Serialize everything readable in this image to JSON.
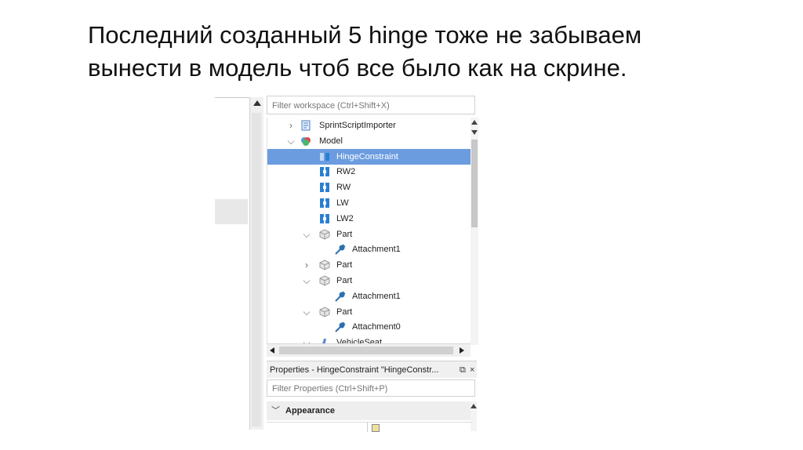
{
  "slide": {
    "title_line1": "Последний созданный 5 hinge тоже не забываем",
    "title_line2": "вынести в модель чтоб все было как на скрине."
  },
  "explorer": {
    "filter_placeholder": "Filter workspace (Ctrl+Shift+X)",
    "items": [
      {
        "label": "SprintScriptImporter",
        "icon": "script-icon",
        "depth": 0,
        "chevron": "collapsed"
      },
      {
        "label": "Model",
        "icon": "model-icon",
        "depth": 0,
        "chevron": "expanded"
      },
      {
        "label": "HingeConstraint",
        "icon": "constraint-icon",
        "depth": 1,
        "chevron": "none",
        "selected": true
      },
      {
        "label": "RW2",
        "icon": "weld-icon",
        "depth": 1,
        "chevron": "none"
      },
      {
        "label": "RW",
        "icon": "weld-icon",
        "depth": 1,
        "chevron": "none"
      },
      {
        "label": "LW",
        "icon": "weld-icon",
        "depth": 1,
        "chevron": "none"
      },
      {
        "label": "LW2",
        "icon": "weld-icon",
        "depth": 1,
        "chevron": "none"
      },
      {
        "label": "Part",
        "icon": "part-icon",
        "depth": 1,
        "chevron": "expanded"
      },
      {
        "label": "Attachment1",
        "icon": "attachment-icon",
        "depth": 2,
        "chevron": "none"
      },
      {
        "label": "Part",
        "icon": "part-icon",
        "depth": 1,
        "chevron": "collapsed"
      },
      {
        "label": "Part",
        "icon": "part-icon",
        "depth": 1,
        "chevron": "expanded"
      },
      {
        "label": "Attachment1",
        "icon": "attachment-icon",
        "depth": 2,
        "chevron": "none"
      },
      {
        "label": "Part",
        "icon": "part-icon",
        "depth": 1,
        "chevron": "expanded"
      },
      {
        "label": "Attachment0",
        "icon": "attachment-icon",
        "depth": 2,
        "chevron": "none"
      },
      {
        "label": "VehicleSeat",
        "icon": "seat-icon",
        "depth": 1,
        "chevron": "expanded"
      }
    ]
  },
  "properties": {
    "header": "Properties - HingeConstraint \"HingeConstr...",
    "dock_glyph": "⧉",
    "close_glyph": "×",
    "filter_placeholder": "Filter Properties (Ctrl+Shift+P)",
    "section": "Appearance"
  },
  "colors": {
    "selection": "#6c9ce0",
    "weld_icon": "#2a7fd4",
    "attachment_icon": "#2b6fb0"
  }
}
